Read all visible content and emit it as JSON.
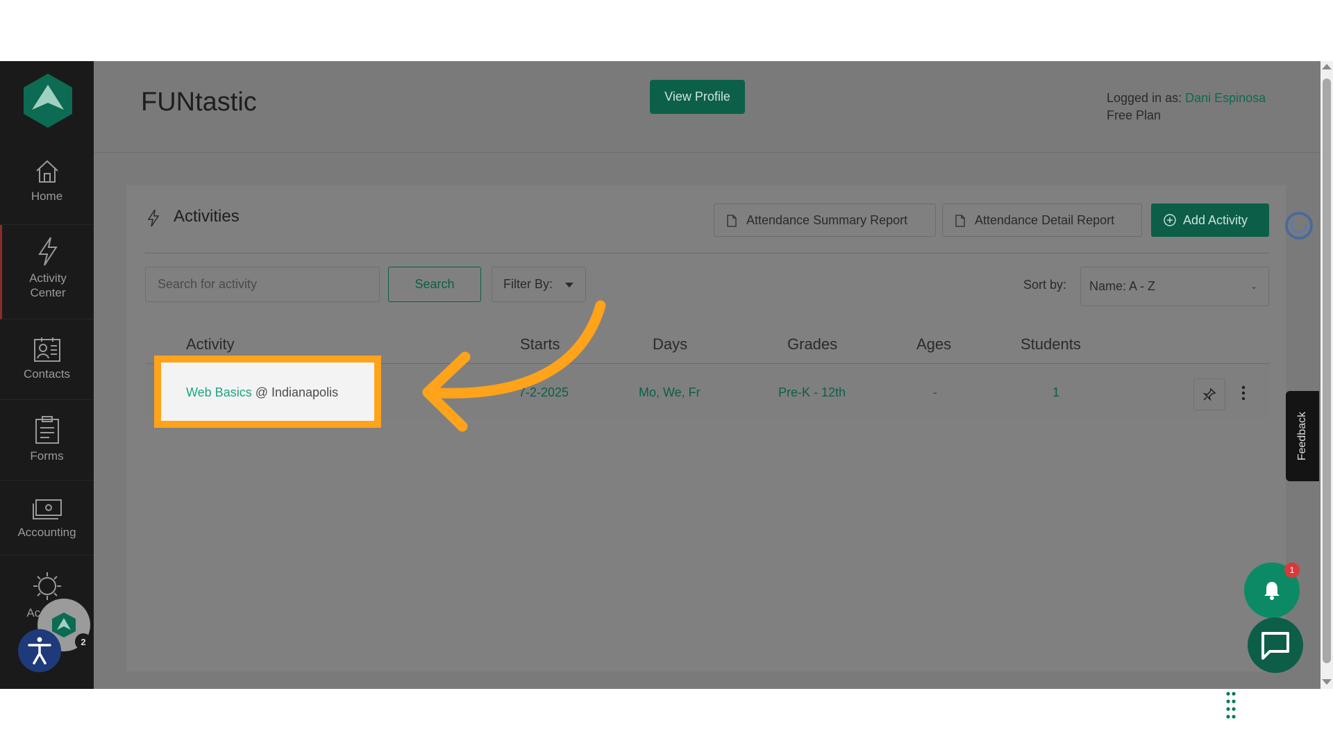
{
  "app": {
    "title": "FUNtastic"
  },
  "header": {
    "view_profile_label": "View Profile",
    "logged_in_prefix": "Logged in as:",
    "user_name": "Dani Espinosa",
    "plan": "Free Plan"
  },
  "sidebar": {
    "items": [
      {
        "label": "Home",
        "icon": "home-icon"
      },
      {
        "label": "Activity Center",
        "icon": "bolt-icon",
        "active": true
      },
      {
        "label": "Contacts",
        "icon": "contacts-icon"
      },
      {
        "label": "Forms",
        "icon": "clipboard-icon"
      },
      {
        "label": "Accounting",
        "icon": "cash-icon"
      },
      {
        "label": "Acc",
        "icon": "gear-icon"
      }
    ],
    "avatar_badge": "2"
  },
  "activities": {
    "title": "Activities",
    "attendance_summary_label": "Attendance Summary Report",
    "attendance_detail_label": "Attendance Detail Report",
    "add_activity_label": "Add Activity",
    "search_placeholder": "Search for activity",
    "search_label": "Search",
    "filter_label": "Filter By:",
    "sort_label": "Sort by:",
    "sort_value": "Name: A - Z",
    "columns": [
      "Activity",
      "Starts",
      "Days",
      "Grades",
      "Ages",
      "Students"
    ],
    "rows": [
      {
        "activity_name": "Web Basics",
        "activity_location": "@ Indianapolis",
        "starts": "7-2-2025",
        "days": "Mo, We, Fr",
        "grades": "Pre-K - 12th",
        "ages": "-",
        "students": "1"
      }
    ]
  },
  "widgets": {
    "feedback_label": "Feedback",
    "notification_count": "1"
  },
  "colors": {
    "brand_green": "#0c5e48",
    "link_green": "#1aa57e",
    "highlight_orange": "#ffa31a",
    "sidebar_bg": "#1a1a1a"
  }
}
